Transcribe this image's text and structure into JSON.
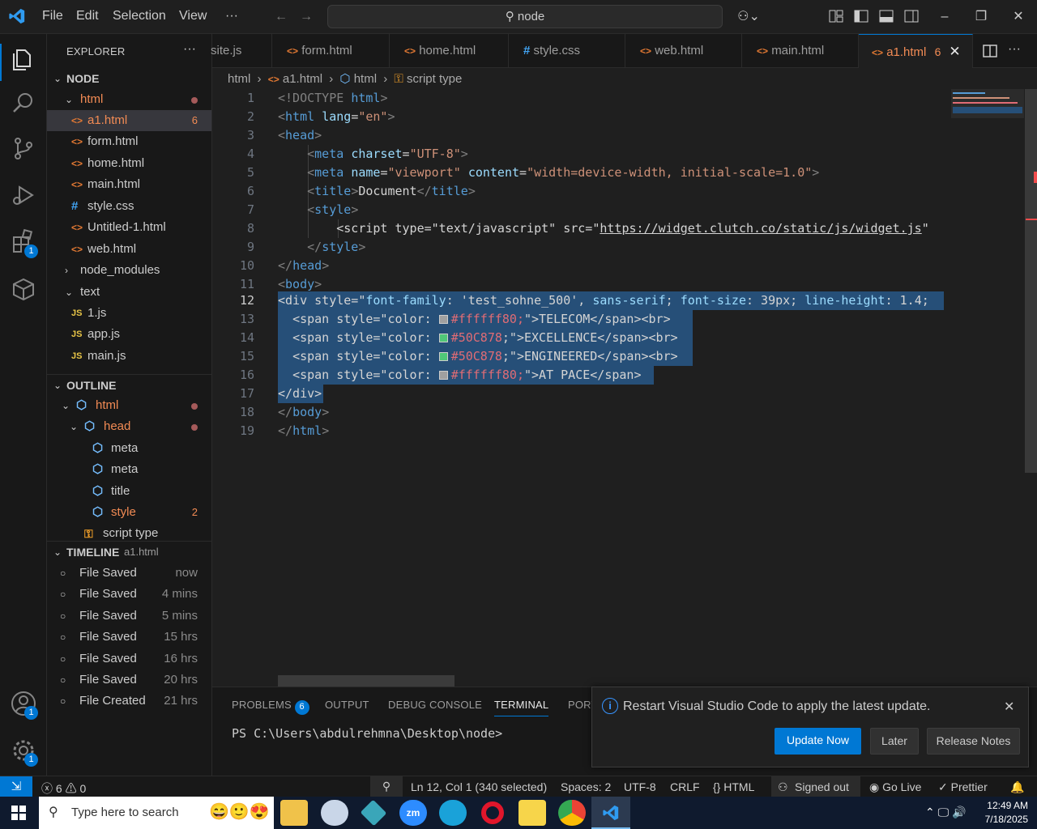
{
  "titlebar": {
    "menu": [
      "File",
      "Edit",
      "Selection",
      "View",
      "···"
    ],
    "search_text": "node"
  },
  "activity": {
    "extensions_badge": "1",
    "accounts_badge": "1",
    "settings_badge": "1"
  },
  "explorer": {
    "title": "EXPLORER",
    "more": "···",
    "root": "NODE",
    "html_folder": "html",
    "html_files": [
      {
        "name": "a1.html",
        "count": "6",
        "selected": true
      },
      {
        "name": "form.html"
      },
      {
        "name": "home.html"
      },
      {
        "name": "main.html"
      },
      {
        "name": "style.css",
        "icon": "#"
      },
      {
        "name": "Untitled-1.html"
      },
      {
        "name": "web.html"
      }
    ],
    "node_modules": "node_modules",
    "text_folder": "text",
    "js_files": [
      "1.js",
      "app.js",
      "main.js"
    ]
  },
  "outline": {
    "title": "OUTLINE",
    "items": [
      {
        "label": "html",
        "level": 0
      },
      {
        "label": "head",
        "level": 1
      },
      {
        "label": "meta",
        "level": 2
      },
      {
        "label": "meta",
        "level": 2
      },
      {
        "label": "title",
        "level": 2
      },
      {
        "label": "style",
        "level": 2,
        "count": "2"
      },
      {
        "label": "script type",
        "level": 1
      }
    ]
  },
  "timeline": {
    "title": "TIMELINE",
    "file": "a1.html",
    "items": [
      {
        "label": "File Saved",
        "time": "now"
      },
      {
        "label": "File Saved",
        "time": "4 mins"
      },
      {
        "label": "File Saved",
        "time": "5 mins"
      },
      {
        "label": "File Saved",
        "time": "15 hrs"
      },
      {
        "label": "File Saved",
        "time": "16 hrs"
      },
      {
        "label": "File Saved",
        "time": "20 hrs"
      },
      {
        "label": "File Created",
        "time": "21 hrs"
      }
    ]
  },
  "tabs": [
    {
      "label": "site.js",
      "icon": "JS"
    },
    {
      "label": "form.html",
      "icon": "<>"
    },
    {
      "label": "home.html",
      "icon": "<>"
    },
    {
      "label": "style.css",
      "icon": "#"
    },
    {
      "label": "web.html",
      "icon": "<>"
    },
    {
      "label": "main.html",
      "icon": "<>"
    },
    {
      "label": "a1.html",
      "icon": "<>",
      "count": "6",
      "active": true
    }
  ],
  "breadcrumb": [
    "html",
    "a1.html",
    "html",
    "script type"
  ],
  "code": {
    "line_numbers": [
      "1",
      "2",
      "3",
      "4",
      "5",
      "6",
      "7",
      "8",
      "9",
      "10",
      "11",
      "12",
      "13",
      "14",
      "15",
      "16",
      "17",
      "18",
      "19"
    ],
    "l1_a": "<!DOCTYPE",
    "l1_b": "html",
    "l1_c": ">",
    "l2_a": "<",
    "l2_b": "html",
    "l2_c": "lang",
    "l2_d": "=",
    "l2_e": "\"en\"",
    "l2_f": ">",
    "l3_a": "<",
    "l3_b": "head",
    "l3_c": ">",
    "l4_a": "<",
    "l4_b": "meta",
    "l4_c": "charset",
    "l4_d": "=",
    "l4_e": "\"UTF-8\"",
    "l4_f": ">",
    "l5_a": "<",
    "l5_b": "meta",
    "l5_c": "name",
    "l5_d": "=",
    "l5_e": "\"viewport\"",
    "l5_f": "content",
    "l5_g": "=",
    "l5_h": "\"width=device-width, initial-scale=1.0\"",
    "l5_i": ">",
    "l6_a": "<",
    "l6_b": "title",
    "l6_c": ">",
    "l6_d": "Document",
    "l6_e": "</",
    "l6_f": "title",
    "l6_g": ">",
    "l7_a": "<",
    "l7_b": "style",
    "l7_c": ">",
    "l8_a": "<script type=\"text/javascript\" src=\"",
    "l8_b": "https://widget.clutch.co/static/js/widget.js",
    "l8_c": "\"",
    "l9_a": "</",
    "l9_b": "style",
    "l9_c": ">",
    "l10_a": "</",
    "l10_b": "head",
    "l10_c": ">",
    "l11_a": "<",
    "l11_b": "body",
    "l11_c": ">",
    "l12_a": "<div style=\"",
    "l12_b": "font-family",
    "l12_c": ": ",
    "l12_d": "'test_sohne_500'",
    "l12_e": ", ",
    "l12_f": "sans-serif",
    "l12_g": "; ",
    "l12_h": "font-size",
    "l12_i": ": 39px; ",
    "l12_j": "line-height",
    "l12_k": ": 1.4;",
    "l13_a": "<span style=\"color: ",
    "l13_b": "#ffffff80;",
    "l13_c": "\">TELECOM</span><br>",
    "l14_a": "<span style=\"color: ",
    "l14_b": "#50C878",
    "l14_c": ";\">EXCELLENCE</span><br>",
    "l15_a": "<span style=\"color: ",
    "l15_b": "#50C878",
    "l15_c": ";\">ENGINEERED</span><br>",
    "l16_a": "<span style=\"color: ",
    "l16_b": "#ffffff80;",
    "l16_c": "\">AT PACE</span>",
    "l17": "</div>",
    "l18_a": "</",
    "l18_b": "body",
    "l18_c": ">",
    "l19_a": "</",
    "l19_b": "html",
    "l19_c": ">"
  },
  "panel": {
    "tabs": [
      "PROBLEMS",
      "OUTPUT",
      "DEBUG CONSOLE",
      "TERMINAL",
      "PORT"
    ],
    "problems_count": "6",
    "terminal_prompt": "PS C:\\Users\\abdulrehmna\\Desktop\\node>"
  },
  "notification": {
    "message": "Restart Visual Studio Code to apply the latest update.",
    "update_now": "Update Now",
    "later": "Later",
    "release_notes": "Release Notes"
  },
  "statusbar": {
    "errors": "6",
    "warnings": "0",
    "position": "Ln 12, Col 1 (340 selected)",
    "spaces": "Spaces: 2",
    "encoding": "UTF-8",
    "eol": "CRLF",
    "language": "HTML",
    "account": "Signed out",
    "golive": "Go Live",
    "prettier": "Prettier"
  },
  "taskbar": {
    "search_placeholder": "Type here to search",
    "time": "12:49 AM",
    "date": "7/18/2025"
  },
  "colors": {
    "accent": "#0078d4",
    "swatch_white": "#ffffff80",
    "swatch_green": "#50C878",
    "modified_tab": "#f28b54"
  }
}
